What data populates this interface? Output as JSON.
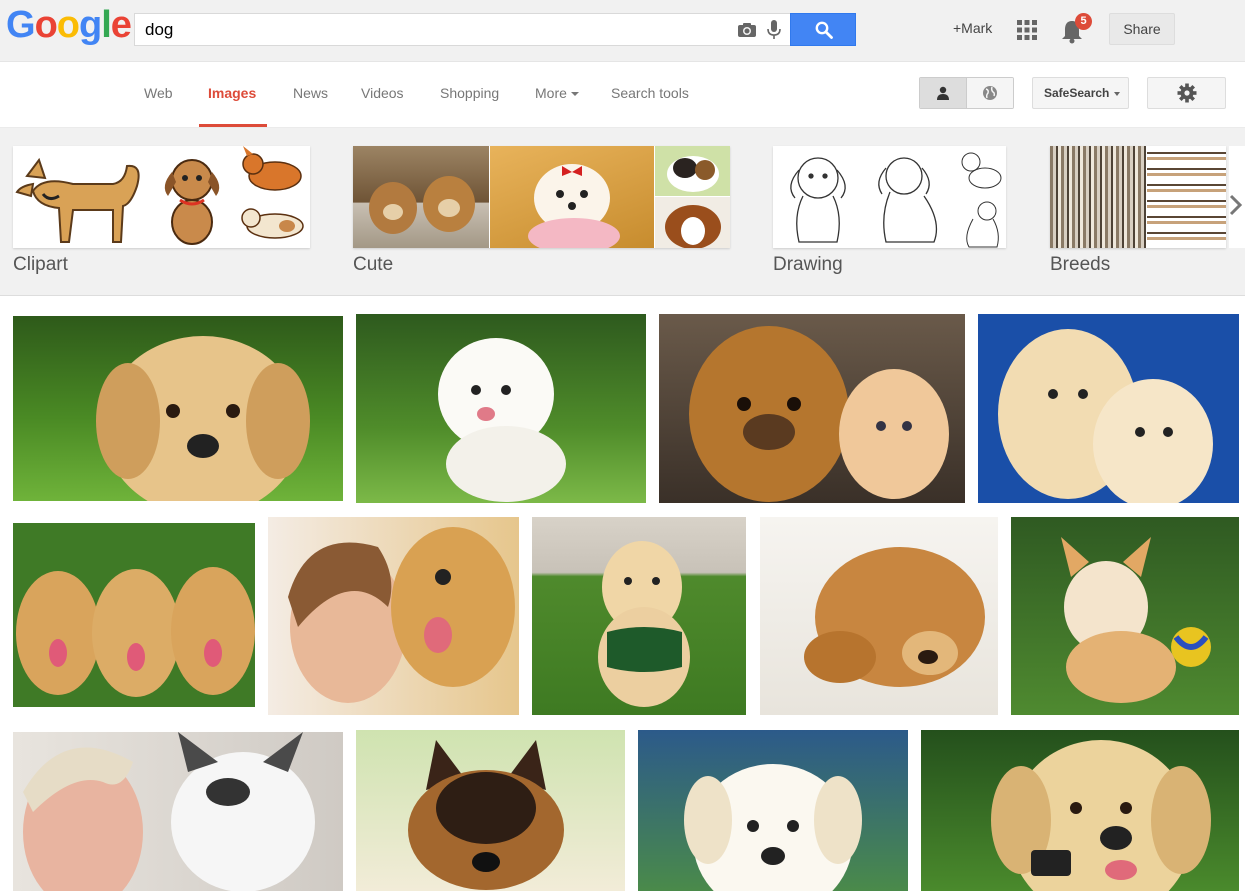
{
  "logo": {
    "text": "Google"
  },
  "search": {
    "query": "dog"
  },
  "header": {
    "plus_mark": "+Mark",
    "notif_count": "5",
    "share_label": "Share"
  },
  "nav": {
    "tabs": [
      "Web",
      "Images",
      "News",
      "Videos",
      "Shopping",
      "More",
      "Search tools"
    ],
    "active": "Images",
    "safesearch_label": "SafeSearch"
  },
  "related": [
    {
      "label": "Clipart"
    },
    {
      "label": "Cute"
    },
    {
      "label": "Drawing"
    },
    {
      "label": "Breeds"
    }
  ],
  "colors": {
    "accent": "#dd4b39",
    "search_button": "#4285f4",
    "topbar": "#f1f1f1"
  },
  "icons": [
    "camera-icon",
    "mic-icon",
    "search-icon",
    "apps-icon",
    "bell-icon",
    "person-icon",
    "globe-icon",
    "gear-icon",
    "chevron-right-icon"
  ]
}
